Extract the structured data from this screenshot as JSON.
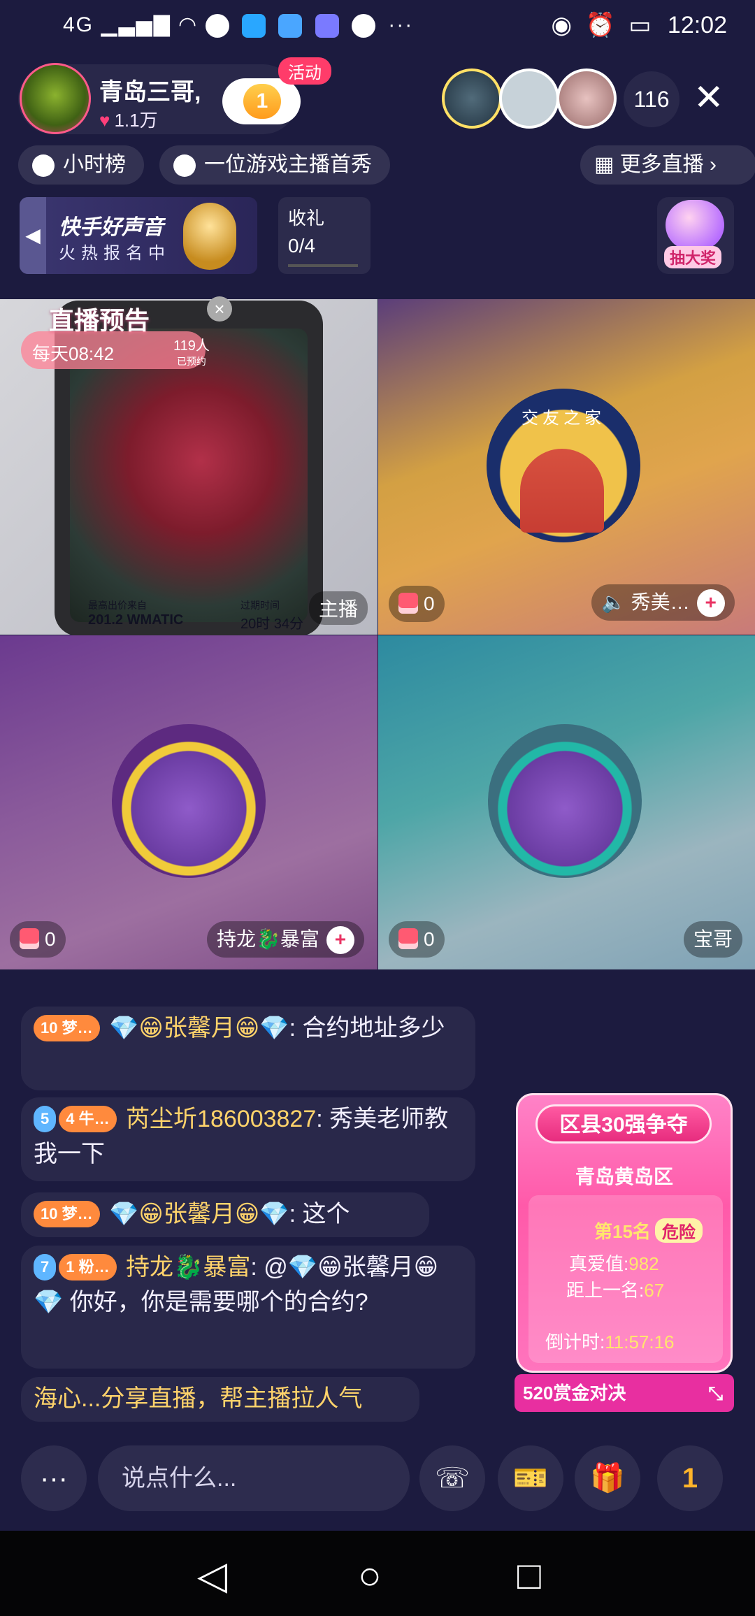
{
  "status_bar": {
    "network": "4G",
    "time": "12:02"
  },
  "anchor": {
    "name": "青岛三哥,",
    "likes": "1.1万",
    "fan_level": "1",
    "activity_tag": "活动"
  },
  "viewers": {
    "count": "116"
  },
  "chips": {
    "hour_rank": "小时榜",
    "game_first": "一位游戏主播首秀",
    "more_live": "更多直播"
  },
  "banner": {
    "title": "快手好声音",
    "subtitle": "火热报名中"
  },
  "gift_task": {
    "label": "收礼",
    "progress": "0/4"
  },
  "lottery": {
    "label": "抽大奖"
  },
  "grid": {
    "host": {
      "preview_title": "直播预告",
      "preview_time": "每天08:42",
      "preview_count": "119人",
      "preview_count_sub": "已预约",
      "price": "201.2 WMATIC",
      "duration": "20时 34分",
      "price_label": "最高出价来自",
      "time_label": "过期时间",
      "tag": "主播"
    },
    "guest1": {
      "gifts": "0",
      "name": "秀美…",
      "logo_text": "交友之家"
    },
    "guest2": {
      "gifts": "0",
      "name": "持龙🐉暴富"
    },
    "guest3": {
      "gifts": "0",
      "name": "宝哥"
    }
  },
  "chat": [
    {
      "badges": [
        "10 梦…"
      ],
      "user": "💎😁张馨月😁💎",
      "text": ": 合约地址多少"
    },
    {
      "badges": [
        "5",
        "4 牛…"
      ],
      "user": "芮尘圻186003827",
      "text": ": 秀美老师教我一下"
    },
    {
      "badges": [
        "10 梦…"
      ],
      "user": "💎😁张馨月😁💎",
      "text": ": 这个"
    },
    {
      "badges": [
        "7",
        "1 粉…"
      ],
      "user": "持龙🐉暴富",
      "text": ": @💎😁张馨月😁💎 你好，你是需要哪个的合约?"
    },
    {
      "badges": [],
      "user": "",
      "text": "海心...分享直播，帮主播拉人气"
    }
  ],
  "rank_card": {
    "title": "区县30强争夺",
    "area": "青岛黄岛区",
    "place": "第15名",
    "status": "危险",
    "love_label": "真爱值:",
    "love_value": "982",
    "gap_label": "距上一名:",
    "gap_value": "67",
    "countdown_label": "倒计时:",
    "countdown": "11:57:16",
    "bounty": "520赏金对决"
  },
  "bottom_bar": {
    "more": "···",
    "input_placeholder": "说点什么...",
    "fan_level": "1"
  }
}
